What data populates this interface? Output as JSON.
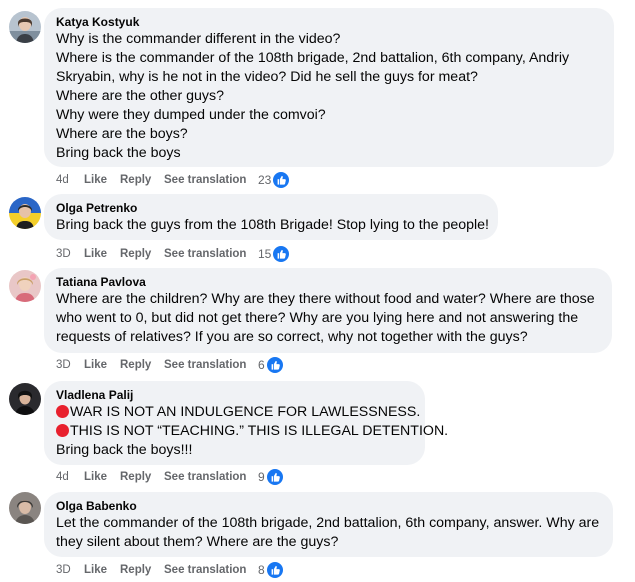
{
  "comments": [
    {
      "author": "Katya Kostyuk",
      "lines": [
        "Why is the commander different in the video?",
        "Where is the commander of the 108th brigade, 2nd battalion, 6th company, Andriy",
        "Skryabin, why is he not in the video? Did he sell the guys for meat?",
        "Where are the other guys?",
        "Why were they dumped under the comvoi?",
        "Where are the boys?",
        "Bring back the boys"
      ],
      "time": "4d",
      "like_label": "Like",
      "reply_label": "Reply",
      "translate_label": "See translation",
      "reactions": "23"
    },
    {
      "author": "Olga Petrenko",
      "lines": [
        "Bring back the guys from the 108th Brigade! Stop lying to the people!"
      ],
      "time": "3D",
      "like_label": "Like",
      "reply_label": "Reply",
      "translate_label": "See translation",
      "reactions": "15"
    },
    {
      "author": "Tatiana Pavlova",
      "lines": [
        "Where are the children? Why are they there without food and water? Where are those",
        "who went to 0, but did not get there? Why are you lying here and not answering the",
        "requests of relatives? If you are so correct, why not together with the guys?"
      ],
      "time": "3D",
      "like_label": "Like",
      "reply_label": "Reply",
      "translate_label": "See translation",
      "reactions": "6"
    },
    {
      "author": "Vladlena Palij",
      "lines": [
        "WAR IS NOT AN INDULGENCE FOR LAWLESSNESS.",
        "THIS IS NOT “TEACHING.” THIS IS ILLEGAL DETENTION.",
        "Bring back the boys!!!"
      ],
      "time": "4d",
      "like_label": "Like",
      "reply_label": "Reply",
      "translate_label": "See translation",
      "reactions": "9"
    },
    {
      "author": "Olga Babenko",
      "lines": [
        "Let the commander of the 108th brigade, 2nd battalion, 6th company, answer. Why are",
        "they silent about them? Where are the guys?"
      ],
      "time": "3D",
      "like_label": "Like",
      "reply_label": "Reply",
      "translate_label": "See translation",
      "reactions": "8"
    }
  ],
  "colors": {
    "bubble": "#f0f2f5",
    "meta": "#65676b",
    "like_badge": "#1877f2",
    "red_circle": "#e8202d"
  },
  "icons": {
    "reaction": "like-thumb-icon",
    "bullet": "red-circle-icon"
  }
}
